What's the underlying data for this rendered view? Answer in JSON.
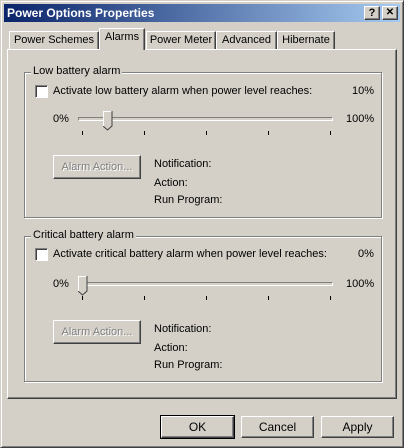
{
  "window": {
    "title": "Power Options Properties",
    "help_label": "?",
    "close_label": "✕"
  },
  "tabs": [
    {
      "label": "Power Schemes"
    },
    {
      "label": "Alarms",
      "active": true
    },
    {
      "label": "Power Meter"
    },
    {
      "label": "Advanced"
    },
    {
      "label": "Hibernate"
    }
  ],
  "low_alarm": {
    "group_label": "Low battery alarm",
    "checkbox_label": "Activate low battery alarm when power level reaches:",
    "checked": false,
    "level": "10%",
    "slider_value": 10,
    "slider_min_label": "0%",
    "slider_max_label": "100%",
    "action_button": "Alarm Action...",
    "notification_label": "Notification:",
    "action_label": "Action:",
    "run_program_label": "Run Program:"
  },
  "critical_alarm": {
    "group_label": "Critical battery alarm",
    "checkbox_label": "Activate critical battery alarm when power level reaches:",
    "checked": false,
    "level": "0%",
    "slider_value": 0,
    "slider_min_label": "0%",
    "slider_max_label": "100%",
    "action_button": "Alarm Action...",
    "notification_label": "Notification:",
    "action_label": "Action:",
    "run_program_label": "Run Program:"
  },
  "buttons": {
    "ok": "OK",
    "cancel": "Cancel",
    "apply": "Apply"
  }
}
